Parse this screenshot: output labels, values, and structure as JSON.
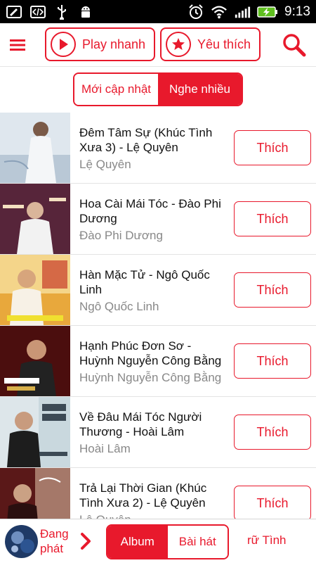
{
  "status_bar": {
    "time": "9:13",
    "icons": [
      "image-edit-icon",
      "code-icon",
      "usb-icon",
      "android-debug-icon",
      "alarm-icon",
      "wifi-icon",
      "signal-icon",
      "battery-charging-icon"
    ]
  },
  "header": {
    "menu_icon": "hamburger-menu-icon",
    "play_button_label": "Play nhanh",
    "favorite_button_label": "Yêu thích",
    "search_icon": "search-icon"
  },
  "tabs": {
    "new": "Mới cập nhật",
    "popular": "Nghe nhiều",
    "active": "popular"
  },
  "songs": [
    {
      "title": "Đêm Tâm Sự (Khúc Tình Xưa 3) - Lệ Quyên",
      "artist": "Lệ Quyên",
      "action": "Thích"
    },
    {
      "title": "Hoa Cài Mái Tóc - Đào Phi Dương",
      "artist": "Đào Phi Dương",
      "action": "Thích"
    },
    {
      "title": "Hàn Mặc Tử - Ngô Quốc Linh",
      "artist": "Ngô Quốc Linh",
      "action": "Thích"
    },
    {
      "title": "Hạnh Phúc Đơn Sơ - Huỳnh Nguyễn Công Bằng",
      "artist": "Huỳnh Nguyễn Công Bằng",
      "action": "Thích"
    },
    {
      "title": "Về Đâu Mái Tóc Người Thương - Hoài Lâm",
      "artist": "Hoài Lâm",
      "action": "Thích"
    },
    {
      "title": "Trả Lại Thời Gian (Khúc Tình Xưa 2) - Lệ Quyên",
      "artist": "Lệ Quyên",
      "action": "Thích"
    }
  ],
  "bottom_bar": {
    "now_playing_label": "Đang phát",
    "album_tab": "Album",
    "songs_tab": "Bài hát",
    "genre": "rữ Tình"
  },
  "colors": {
    "accent": "#e8192c",
    "text": "#111111",
    "muted": "#888888"
  }
}
